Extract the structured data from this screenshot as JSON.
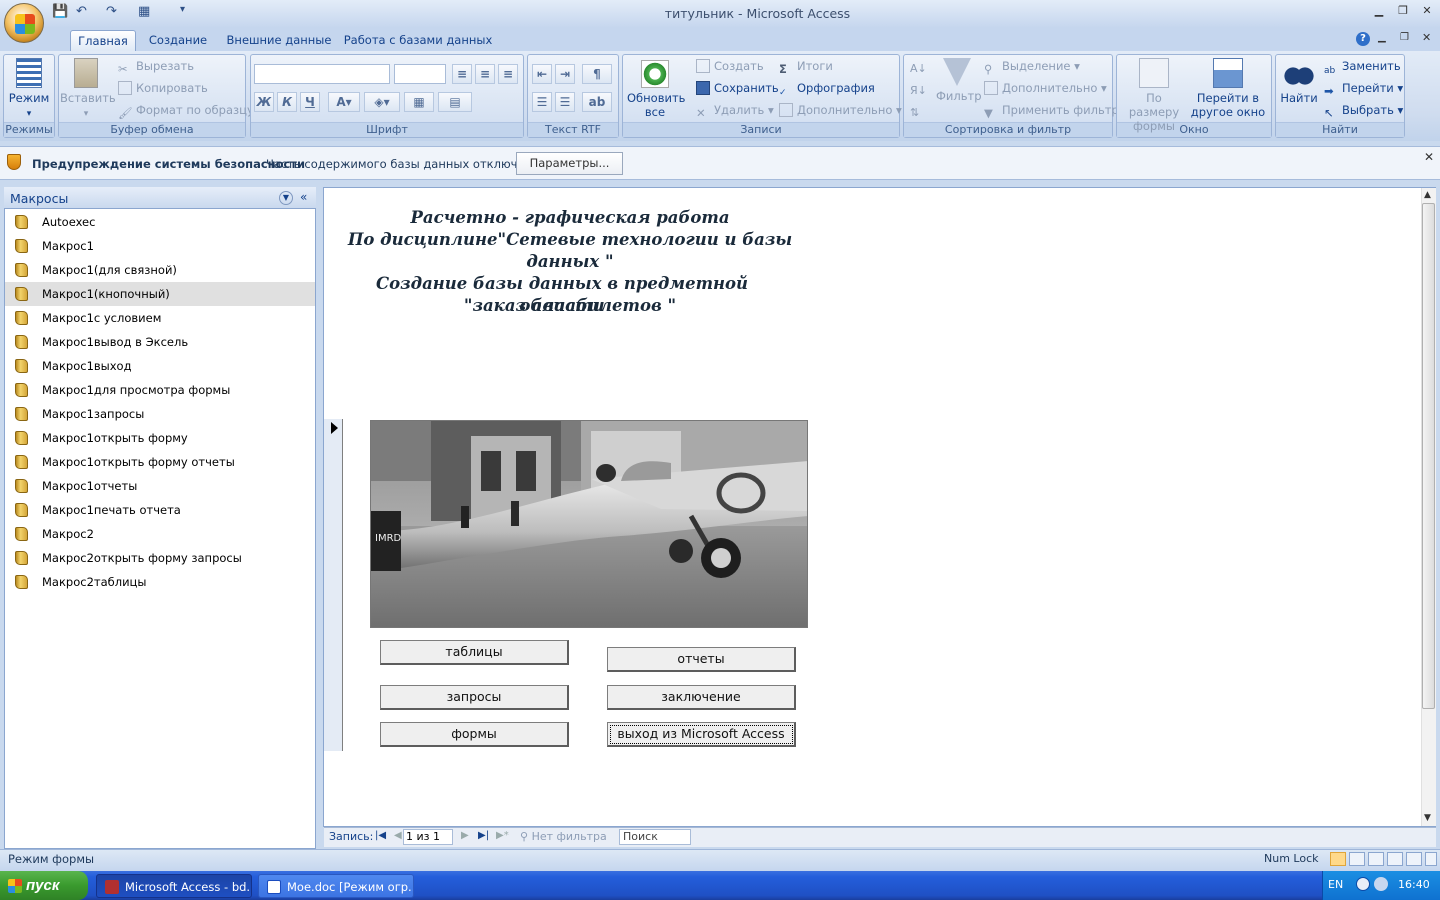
{
  "window": {
    "title": "титульник - Microsoft Access"
  },
  "tabs": [
    "Главная",
    "Создание",
    "Внешние данные",
    "Работа с базами данных"
  ],
  "ribbon": {
    "modes": {
      "view_label": "Режим",
      "group": "Режимы"
    },
    "clipboard": {
      "paste_label": "Вставить",
      "cut": "Вырезать",
      "copy": "Копировать",
      "format_painter": "Формат по образцу",
      "group": "Буфер обмена"
    },
    "font": {
      "bold": "Ж",
      "italic": "К",
      "underline": "Ч",
      "group": "Шрифт"
    },
    "rtf": {
      "group": "Текст RTF"
    },
    "records": {
      "refresh_label": "Обновить все",
      "new": "Создать",
      "save": "Сохранить",
      "delete": "Удалить",
      "totals": "Итоги",
      "spelling": "Орфография",
      "more": "Дополнительно",
      "group": "Записи"
    },
    "sort": {
      "filter_label": "Фильтр",
      "selection": "Выделение",
      "advanced": "Дополнительно",
      "toggle_filter": "Применить фильтр",
      "group": "Сортировка и фильтр"
    },
    "window": {
      "size_to_fit": "По размеру формы",
      "switch_windows": "Перейти в другое окно",
      "group": "Окно"
    },
    "find": {
      "find_label": "Найти",
      "replace": "Заменить",
      "goto": "Перейти",
      "select": "Выбрать",
      "group": "Найти"
    }
  },
  "security": {
    "title": "Предупреждение системы безопасности",
    "message": "Часть содержимого базы данных отключено",
    "button": "Параметры..."
  },
  "nav": {
    "title": "Макросы",
    "items": [
      "Autoexec",
      "Макрос1",
      "Макрос1(для связной)",
      "Макрос1(кнопочный)",
      "Макрос1с условием",
      "Макрос1вывод в Эксель",
      "Макрос1выход",
      "Макрос1для просмотра формы",
      "Макрос1запросы",
      "Макрос1открыть форму",
      "Макрос1открыть форму отчеты",
      "Макрос1отчеты",
      "Макрос1печать отчета",
      "Макрос2",
      "Макрос2открыть форму запросы",
      "Макрос2таблицы"
    ],
    "selected_index": 3
  },
  "form": {
    "title_lines": [
      "Расчетно - графическая работа",
      "По дисциплине\"Сетевые технологии и базы",
      "данных \"",
      "Создание базы данных в предметной области",
      "\"заказ авиабилетов \""
    ],
    "buttons": {
      "tables": "таблицы",
      "reports": "отчеты",
      "queries": "запросы",
      "conclusion": "заключение",
      "forms": "формы",
      "exit": "выход из Microsoft Access"
    }
  },
  "record_nav": {
    "label": "Запись:",
    "position": "1 из 1",
    "filter": "Нет фильтра",
    "search": "Поиск"
  },
  "status": {
    "mode": "Режим формы",
    "numlock": "Num Lock"
  },
  "taskbar": {
    "start": "пуск",
    "items": [
      "Microsoft Access - bd...",
      "Мое.doc [Режим огр..."
    ],
    "lang": "EN",
    "time": "16:40"
  }
}
